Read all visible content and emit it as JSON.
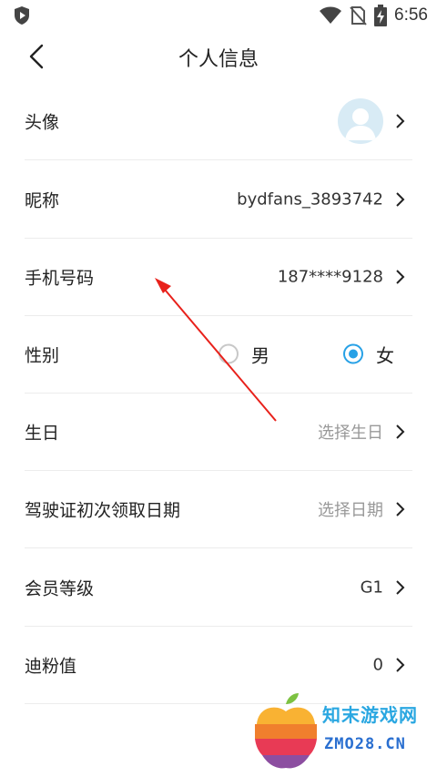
{
  "status_bar": {
    "time": "6:56"
  },
  "header": {
    "title": "个人信息"
  },
  "rows": {
    "avatar": {
      "label": "头像"
    },
    "nickname": {
      "label": "昵称",
      "value": "bydfans_3893742"
    },
    "phone": {
      "label": "手机号码",
      "value": "187****9128"
    },
    "gender": {
      "label": "性别",
      "options": [
        "男",
        "女"
      ],
      "selected": "女"
    },
    "birthday": {
      "label": "生日",
      "placeholder": "选择生日"
    },
    "license_date": {
      "label": "驾驶证初次领取日期",
      "placeholder": "选择日期"
    },
    "member_level": {
      "label": "会员等级",
      "value": "G1"
    },
    "di_fen": {
      "label": "迪粉值",
      "value": "0"
    }
  },
  "watermark": {
    "cn": "知末游戏网",
    "en": "ZMO28.CN"
  },
  "colors": {
    "accent": "#27a1e6",
    "annotation_arrow": "#e8211b"
  }
}
